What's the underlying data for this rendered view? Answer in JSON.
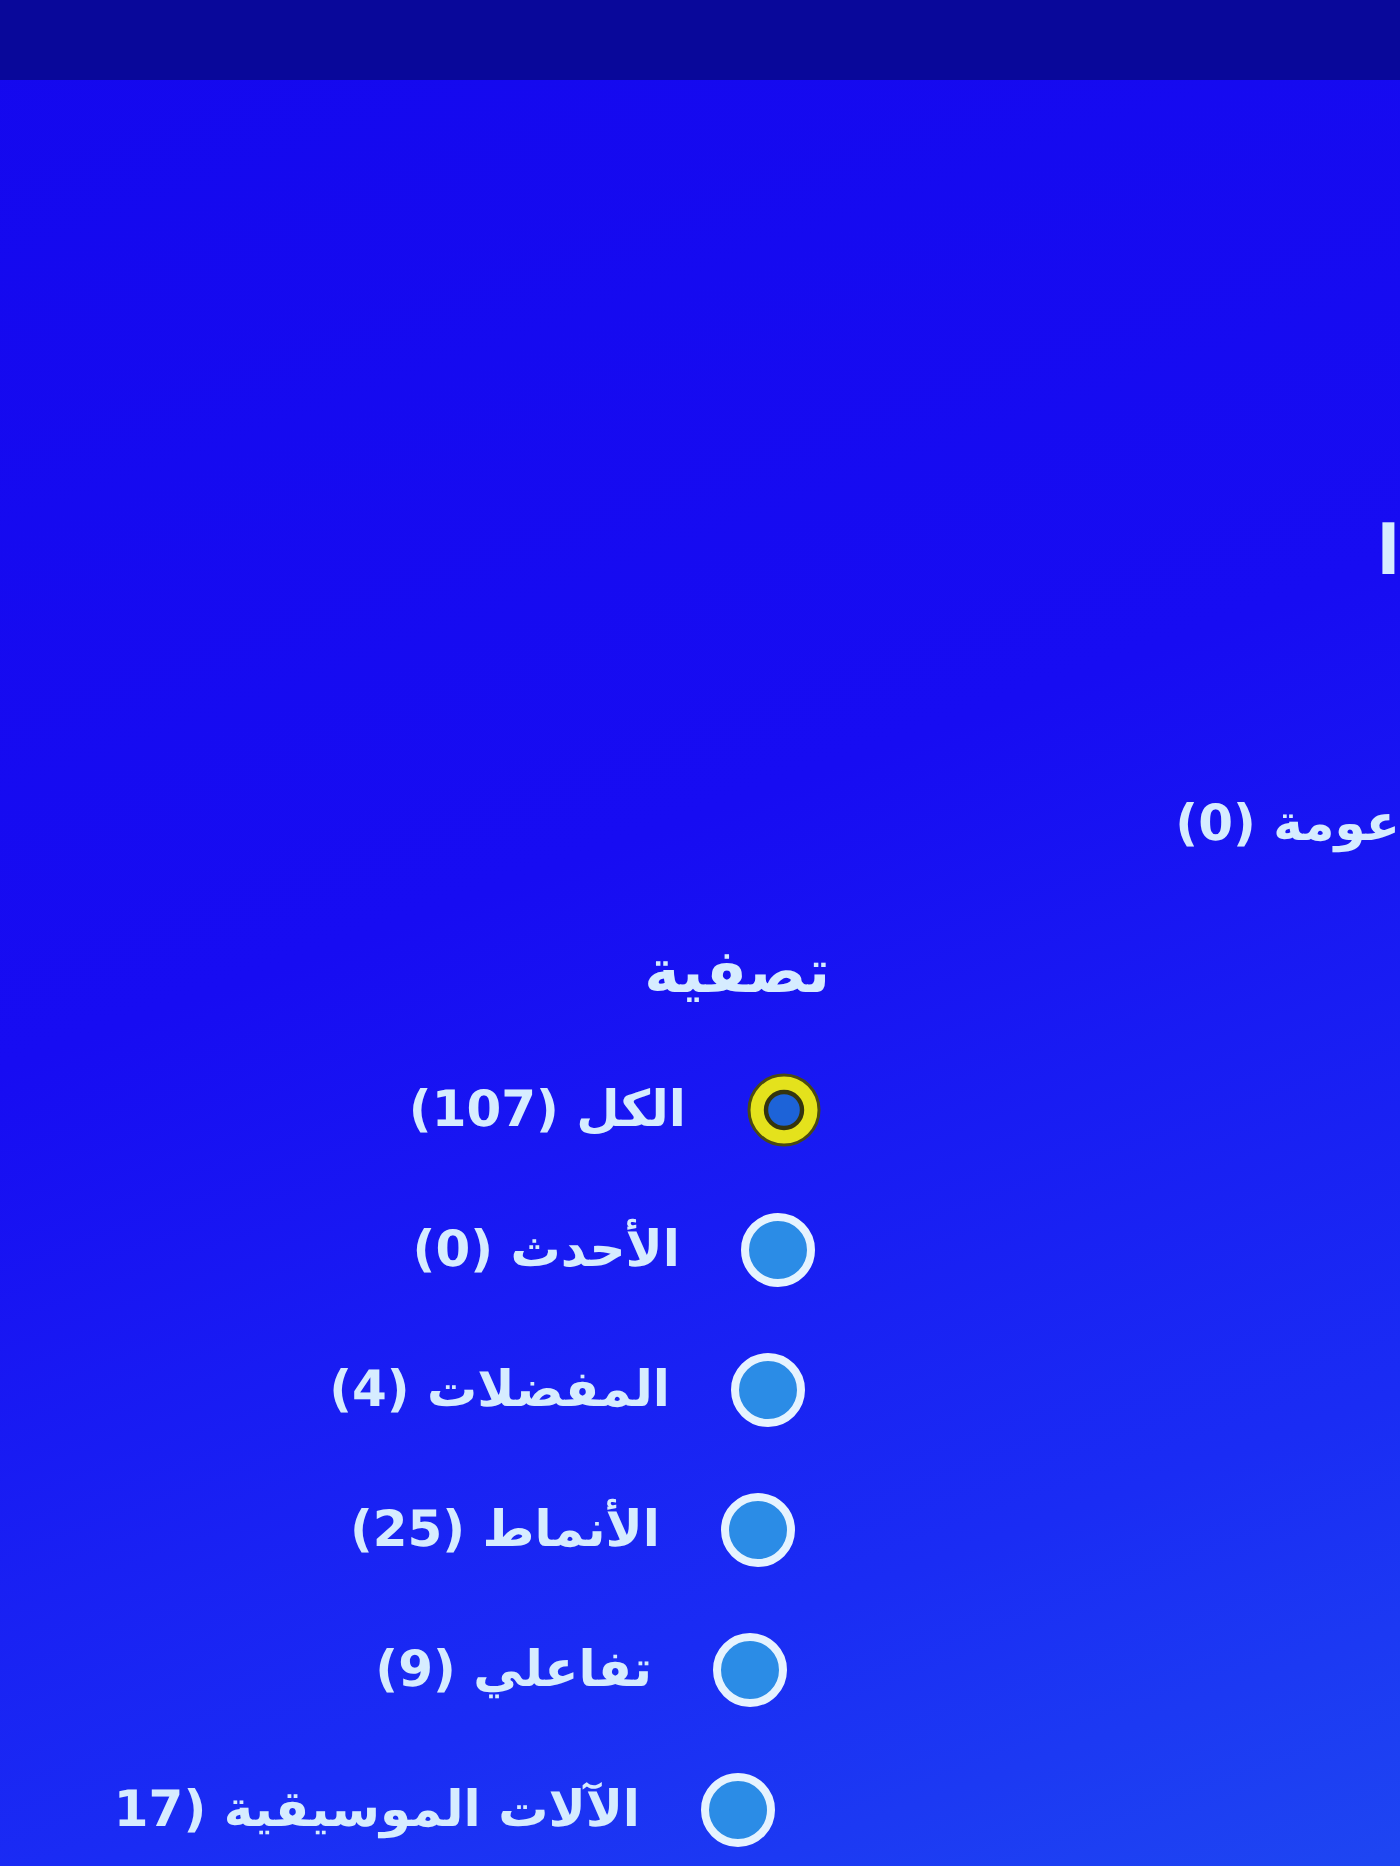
{
  "side_panel": {
    "heading": "ا",
    "item": "عومة (0)"
  },
  "filter": {
    "title": "تصفية",
    "options": [
      {
        "label": "الكل (107)",
        "selected": true
      },
      {
        "label": "الأحدث (0)",
        "selected": false
      },
      {
        "label": "المفضلات (4)",
        "selected": false
      },
      {
        "label": "الأنماط (25)",
        "selected": false
      },
      {
        "label": "تفاعلي (9)",
        "selected": false
      },
      {
        "label": "الآلات الموسيقية (17",
        "selected": false
      }
    ]
  }
}
